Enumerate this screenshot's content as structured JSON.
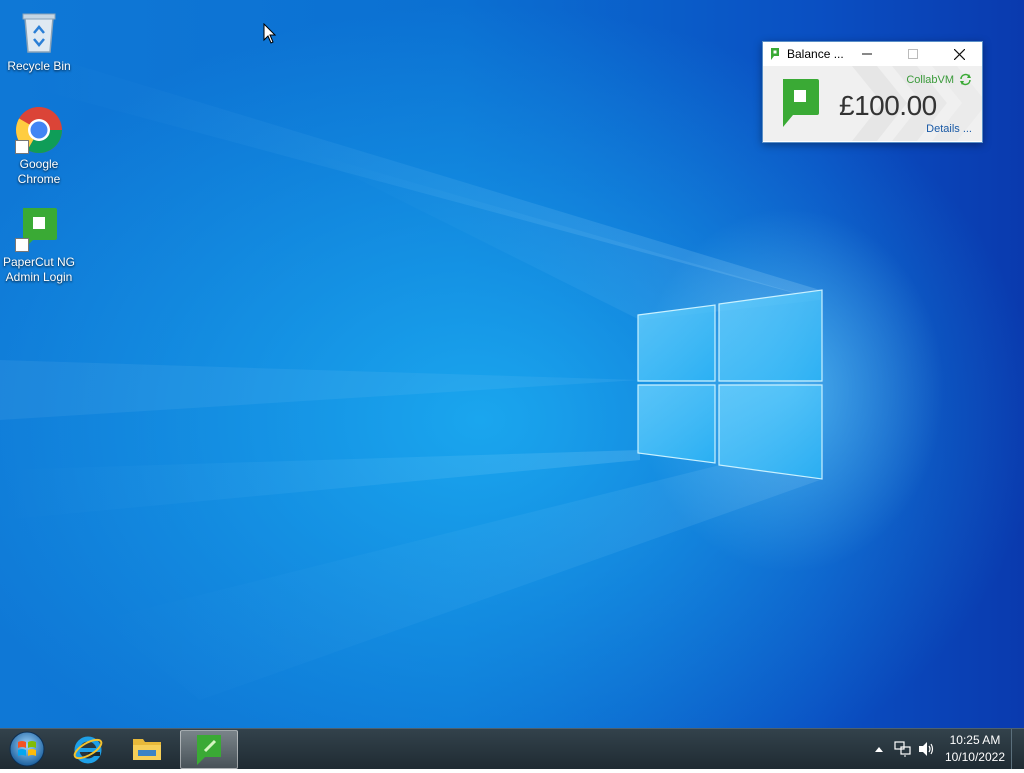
{
  "desktop": {
    "icons": [
      {
        "label": "Recycle Bin",
        "icon": "recycle-bin-icon"
      },
      {
        "label": "Google Chrome",
        "icon": "chrome-icon"
      },
      {
        "label": "PaperCut NG Admin Login",
        "icon": "papercut-icon"
      }
    ]
  },
  "balance_window": {
    "title": "Balance ...",
    "username": "CollabVM",
    "amount": "£100.00",
    "details_label": "Details ...",
    "buttons": {
      "minimize": "minimize-icon",
      "maximize": "maximize-icon",
      "close": "close-icon"
    },
    "accent_color": "#3aaa35"
  },
  "taskbar": {
    "items": [
      {
        "name": "start-button",
        "icon": "windows-start-orb-icon"
      },
      {
        "name": "internet-explorer",
        "icon": "internet-explorer-icon"
      },
      {
        "name": "file-explorer",
        "icon": "folder-icon"
      },
      {
        "name": "papercut-client",
        "icon": "papercut-icon",
        "active": true
      }
    ],
    "tray": {
      "icons": [
        "show-hidden-icons-icon",
        "network-icon",
        "volume-icon"
      ],
      "time": "10:25 AM",
      "date": "10/10/2022"
    }
  }
}
